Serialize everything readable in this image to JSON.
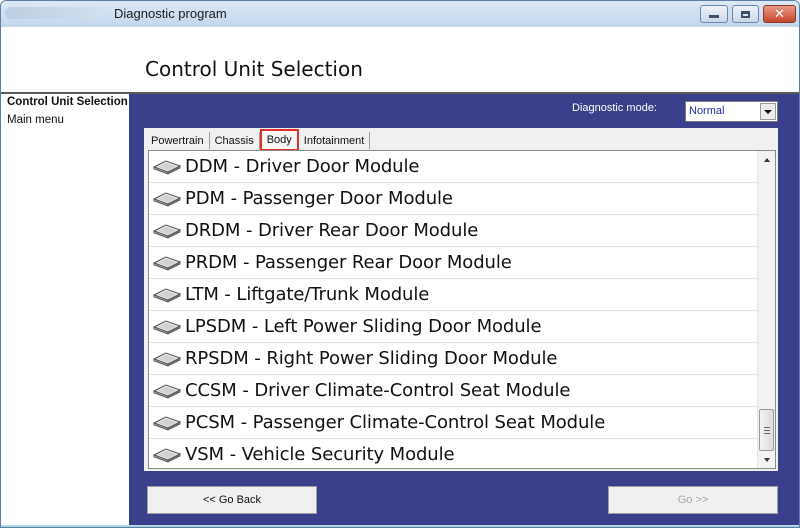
{
  "window": {
    "title": "Diagnostic program",
    "controls": {
      "minimize": "minimize",
      "maximize": "maximize",
      "close": "✕"
    }
  },
  "header": {
    "title": "Control Unit Selection"
  },
  "sidebar": {
    "items": [
      {
        "label": "Control Unit Selection",
        "active": true
      },
      {
        "label": "Main menu",
        "active": false
      }
    ]
  },
  "main": {
    "mode_label": "Diagnostic mode:",
    "mode_value": "Normal",
    "tabs": [
      {
        "label": "Powertrain",
        "active": false
      },
      {
        "label": "Chassis",
        "active": false
      },
      {
        "label": "Body",
        "active": true
      },
      {
        "label": "Infotainment",
        "active": false
      }
    ],
    "modules": [
      {
        "label": "DDM - Driver Door Module",
        "icon": "module-chip-icon"
      },
      {
        "label": "PDM - Passenger Door Module",
        "icon": "module-chip-icon"
      },
      {
        "label": "DRDM - Driver Rear Door Module",
        "icon": "module-chip-icon"
      },
      {
        "label": "PRDM - Passenger Rear Door Module",
        "icon": "module-chip-icon"
      },
      {
        "label": "LTM - Liftgate/Trunk Module",
        "icon": "module-chip-icon"
      },
      {
        "label": "LPSDM - Left Power Sliding Door Module",
        "icon": "module-chip-icon"
      },
      {
        "label": "RPSDM - Right Power Sliding Door Module",
        "icon": "module-chip-icon"
      },
      {
        "label": "CCSM - Driver Climate-Control Seat Module",
        "icon": "module-chip-icon"
      },
      {
        "label": "PCSM - Passenger Climate-Control Seat Module",
        "icon": "module-chip-icon"
      },
      {
        "label": "VSM - Vehicle Security Module",
        "icon": "module-chip-icon"
      }
    ],
    "back_label": "<< Go Back",
    "go_label": "Go >>"
  },
  "colors": {
    "panel_bg": "#3a3f8c",
    "tab_highlight": "#e0312b",
    "select_text": "#1f2aa8"
  }
}
